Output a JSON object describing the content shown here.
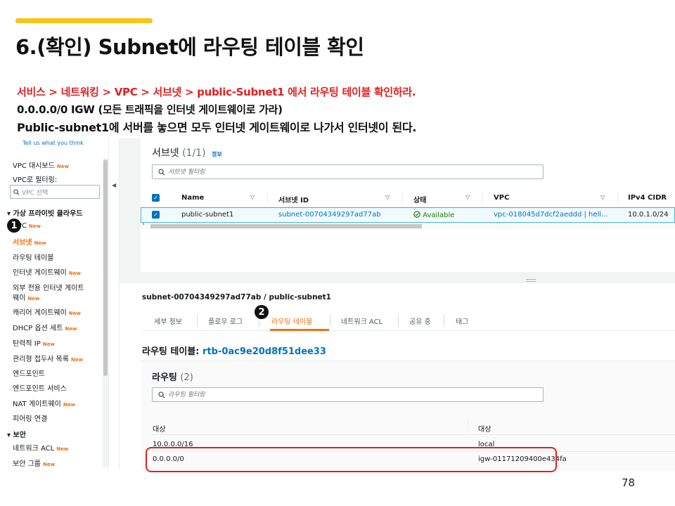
{
  "slide": {
    "title": "6.(확인) Subnet에 라우팅 테이블 확인",
    "desc_line1": "서비스 > 네트워킹 > VPC > 서브넷 > public-Subnet1 에서 라우팅 테이블 확인하라.",
    "desc_line2": "0.0.0.0/0 IGW (모든 트래픽을  인터넷 게이트웨이로 가라)",
    "desc_line3": "Public-subnet1에 서버를 놓으면 모두 인터넷 게이트웨이로 나가서 인터넷이 된다.",
    "page_number": "78",
    "accent_color": "#f5c518",
    "highlight_color": "#e02020"
  },
  "badges": {
    "one": "1",
    "two": "2"
  },
  "sidebar": {
    "feedback_link": "Tell us what you think",
    "new_label": "New",
    "vpc_dashboard": "VPC 대시보드",
    "filter_label": "VPC로 필터링:",
    "select_placeholder": "VPC 선택",
    "section_virtual_cloud": "가상 프라이빗 클라우드",
    "items": [
      "VPC",
      "서브넷",
      "라우팅 테이블",
      "인터넷 게이트웨이",
      "외부 전용 인터넷 게이트",
      "웨이",
      "캐리어 게이트웨이",
      "DHCP 옵션 세트",
      "탄력적 IP",
      "관리형 접두사 목록",
      "엔드포인트",
      "엔드포인트 서비스",
      "NAT 게이트웨이",
      "피어링 연결"
    ],
    "section_security": "보안",
    "security_items": [
      "네트워크 ACL",
      "보안 그룹"
    ],
    "active_item": "서브넷"
  },
  "subnets_panel": {
    "title": "서브넷",
    "count": "(1/1)",
    "info_link": "정보",
    "search_placeholder": "서브넷 필터링",
    "columns": [
      "Name",
      "서브넷 ID",
      "상태",
      "VPC",
      "IPv4 CIDR"
    ],
    "rows": [
      {
        "name": "public-subnet1",
        "subnet_id": "subnet-00704349297ad77ab",
        "status": "Available",
        "vpc": "vpc-018045d7dcf2aeddd | hell...",
        "ipv4_cidr": "10.0.1.0/24"
      }
    ]
  },
  "details_panel": {
    "subnet_title": "subnet-00704349297ad77ab / public-subnet1",
    "tabs": [
      "세부 정보",
      "플로우 로그",
      "라우팅 테이블",
      "네트워크 ACL",
      "공유 중",
      "태그"
    ],
    "active_tab": "라우팅 테이블",
    "route_table_label": "라우팅 테이블:",
    "route_table_id": "rtb-0ac9e20d8f51dee33"
  },
  "routes": {
    "title": "라우팅",
    "count": "(2)",
    "search_placeholder": "라우팅 필터링",
    "columns": [
      "대상",
      "대상"
    ],
    "rows": [
      {
        "destination": "10.0.0.0/16",
        "target": "local"
      },
      {
        "destination": "0.0.0.0/0",
        "target": "igw-01171209400e434fa"
      }
    ]
  }
}
